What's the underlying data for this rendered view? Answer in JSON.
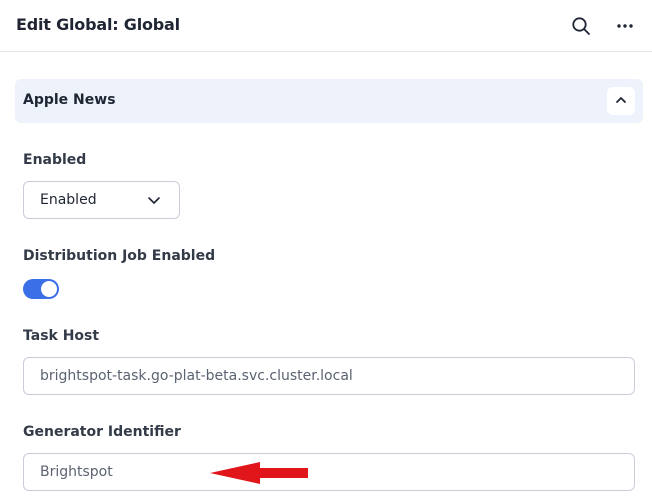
{
  "header": {
    "title": "Edit Global: Global",
    "icons": {
      "search": "search-icon",
      "more": "more-horizontal-icon"
    }
  },
  "section": {
    "title": "Apple News",
    "collapse_icon": "chevron-up-icon"
  },
  "fields": {
    "enabled": {
      "label": "Enabled",
      "value": "Enabled",
      "icon": "chevron-down-icon"
    },
    "distribution_job": {
      "label": "Distribution Job Enabled",
      "on": true
    },
    "task_host": {
      "label": "Task Host",
      "value": "brightspot-task.go-plat-beta.svc.cluster.local"
    },
    "generator_identifier": {
      "label": "Generator Identifier",
      "value": "Brightspot"
    }
  },
  "colors": {
    "accent": "#3a6fe8",
    "section_bg": "#eef2fb",
    "annotation_arrow": "#e0161b"
  }
}
